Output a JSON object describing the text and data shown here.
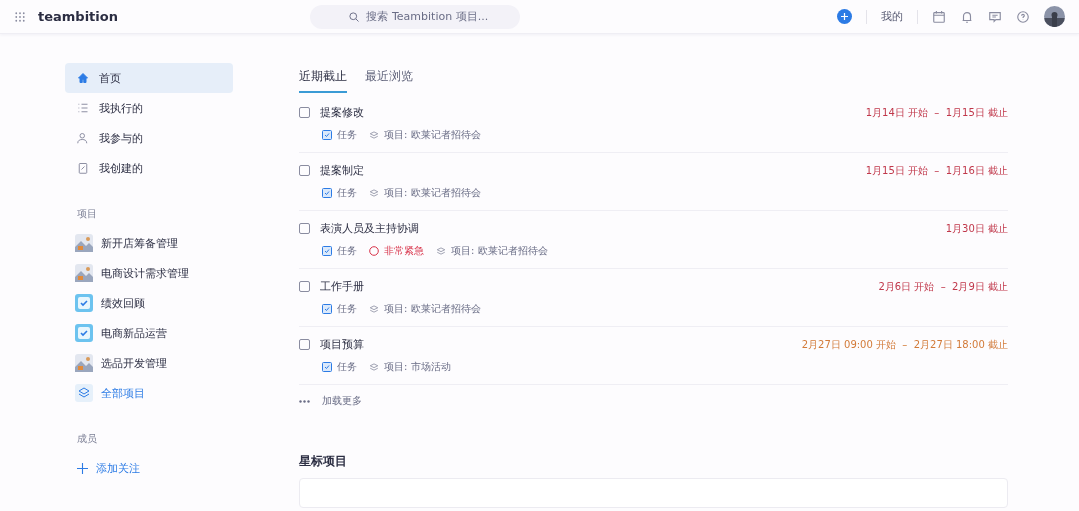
{
  "header": {
    "logo": "teambition",
    "search": {
      "placeholder": "搜索 Teambition 项目..."
    },
    "mine": "我的"
  },
  "sidebar": {
    "nav": [
      {
        "label": "首页",
        "selected": true
      },
      {
        "label": "我执行的",
        "selected": false
      },
      {
        "label": "我参与的",
        "selected": false
      },
      {
        "label": "我创建的",
        "selected": false
      }
    ],
    "projects_title": "项目",
    "projects": [
      {
        "label": "新开店筹备管理",
        "kind": "picture"
      },
      {
        "label": "电商设计需求管理",
        "kind": "picture"
      },
      {
        "label": "绩效回顾",
        "kind": "check"
      },
      {
        "label": "电商新品运营",
        "kind": "check"
      },
      {
        "label": "选品开发管理",
        "kind": "picture"
      },
      {
        "label": "全部项目",
        "kind": "all"
      }
    ],
    "members_title": "成员",
    "add_follow": "添加关注"
  },
  "tabs": [
    {
      "label": "近期截止",
      "selected": true
    },
    {
      "label": "最近浏览",
      "selected": false
    }
  ],
  "tasks": [
    {
      "title": "提案修改",
      "checked": false,
      "type": "任务",
      "project": "项目: 欧莱记者招待会",
      "date": "1月14日 开始  –  1月15日 截止",
      "overdue": true
    },
    {
      "title": "提案制定",
      "checked": false,
      "type": "任务",
      "project": "项目: 欧莱记者招待会",
      "date": "1月15日 开始  –  1月16日 截止",
      "overdue": true
    },
    {
      "title": "表演人员及主持协调",
      "checked": false,
      "type": "任务",
      "priority": "非常紧急",
      "project": "项目: 欧莱记者招待会",
      "date": "1月30日 截止",
      "overdue": true
    },
    {
      "title": "工作手册",
      "checked": false,
      "type": "任务",
      "project": "项目: 欧莱记者招待会",
      "date": "2月6日 开始  –  2月9日 截止",
      "overdue": true
    },
    {
      "title": "项目预算",
      "checked": false,
      "type": "任务",
      "project": "项目: 市场活动",
      "date": "2月27日 09:00 开始  –  2月27日 18:00 截止",
      "overdue": false
    }
  ],
  "load_more": "加载更多",
  "starred_title": "星标项目"
}
